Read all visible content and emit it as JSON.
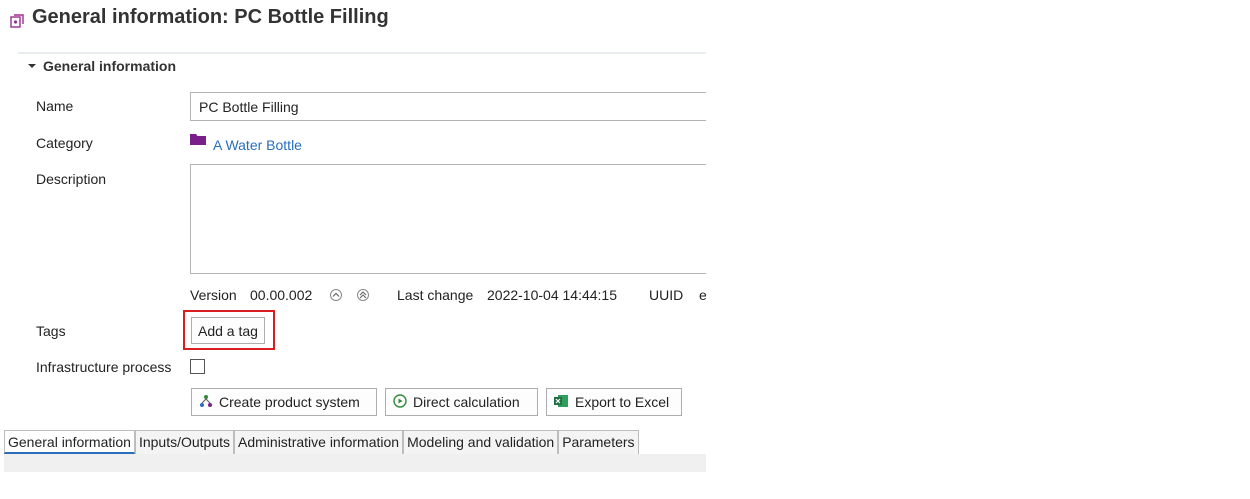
{
  "header": {
    "title": "General information: PC Bottle Filling",
    "icon": "process-icon"
  },
  "section": {
    "title": "General information",
    "icon": "chevron-down-icon"
  },
  "form": {
    "name_label": "Name",
    "name_value": "PC Bottle Filling",
    "category_label": "Category",
    "category_value": "A Water Bottle",
    "description_label": "Description",
    "description_value": "",
    "version_label": "Version",
    "version_value": "00.00.002",
    "last_change_label": "Last change",
    "last_change_value": "2022-10-04 14:44:15",
    "uuid_label": "UUID",
    "uuid_value": "e",
    "tags_label": "Tags",
    "add_tag_label": "Add a tag",
    "infrastructure_label": "Infrastructure process",
    "infrastructure_checked": false
  },
  "actions": {
    "create_product_system": "Create product system",
    "direct_calculation": "Direct calculation",
    "export_to_excel": "Export to Excel"
  },
  "tabs": [
    {
      "label": "General information",
      "active": true
    },
    {
      "label": "Inputs/Outputs",
      "active": false
    },
    {
      "label": "Administrative information",
      "active": false
    },
    {
      "label": "Modeling and validation",
      "active": false
    },
    {
      "label": "Parameters",
      "active": false
    }
  ],
  "colors": {
    "link": "#2a6ebb",
    "folder": "#7a1e8a",
    "highlight": "#d81e1e",
    "excel": "#1d7044",
    "calc": "#2f8a3a"
  }
}
